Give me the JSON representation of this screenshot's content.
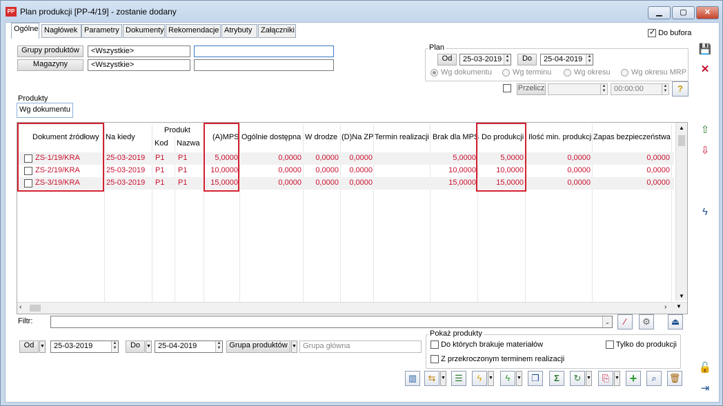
{
  "window": {
    "title": "Plan produkcji [PP-4/19] - zostanie dodany",
    "app_icon": "PP"
  },
  "tabs": [
    "Ogólne",
    "Nagłówek",
    "Parametry",
    "Dokumenty",
    "Rekomendacje",
    "Atrybuty",
    "Załączniki"
  ],
  "do_bufora": {
    "label": "Do bufora",
    "checked": true
  },
  "filters": {
    "grupy_label": "Grupy produktów",
    "grupy_value": "<Wszystkie>",
    "magazyny_label": "Magazyny",
    "magazyny_value": "<Wszystkie>"
  },
  "plan": {
    "label": "Plan",
    "od_label": "Od",
    "od_value": "25-03-2019",
    "do_label": "Do",
    "do_value": "25-04-2019",
    "radios": [
      "Wg dokumentu",
      "Wg terminu",
      "Wg okresu",
      "Wg okresu MRP"
    ],
    "przelicz_label": "Przelicz",
    "time_value": "00:00:00"
  },
  "produkty": {
    "label": "Produkty",
    "subtab": "Wg dokumentu"
  },
  "table": {
    "headers": {
      "dokument": "Dokument źródłowy",
      "na_kiedy": "Na kiedy",
      "produkt": "Produkt",
      "kod": "Kod",
      "nazwa": "Nazwa",
      "amps": "(A)MPS",
      "ogolnie": "Ogólnie dostępna",
      "w_drodze": "W drodze",
      "na_zp": "(D)Na ZP",
      "termin": "Termin realizacji",
      "brak": "Brak dla MPS",
      "do_produkcji": "Do produkcji",
      "ilosc_min": "Ilość min. produkcji",
      "zapas": "Zapas bezpieczeństwa"
    },
    "rows": [
      {
        "doc": "ZS-1/19/KRA",
        "date": "25-03-2019",
        "kod": "P1",
        "nazwa": "P1",
        "amps": "5,0000",
        "ogolnie": "0,0000",
        "w_drodze": "0,0000",
        "na_zp": "0,0000",
        "brak": "5,0000",
        "do_produkcji": "5,0000",
        "ilosc_min": "0,0000",
        "zapas": "0,0000"
      },
      {
        "doc": "ZS-2/19/KRA",
        "date": "25-03-2019",
        "kod": "P1",
        "nazwa": "P1",
        "amps": "10,0000",
        "ogolnie": "0,0000",
        "w_drodze": "0,0000",
        "na_zp": "0,0000",
        "brak": "10,0000",
        "do_produkcji": "10,0000",
        "ilosc_min": "0,0000",
        "zapas": "0,0000"
      },
      {
        "doc": "ZS-3/19/KRA",
        "date": "25-03-2019",
        "kod": "P1",
        "nazwa": "P1",
        "amps": "15,0000",
        "ogolnie": "0,0000",
        "w_drodze": "0,0000",
        "na_zp": "0,0000",
        "brak": "15,0000",
        "do_produkcji": "15,0000",
        "ilosc_min": "0,0000",
        "zapas": "0,0000"
      }
    ]
  },
  "filtr": {
    "label": "Filtr:"
  },
  "bottom": {
    "od_label": "Od",
    "od_value": "25-03-2019",
    "do_label": "Do",
    "do_value": "25-04-2019",
    "grupa_label": "Grupa produktów",
    "grupa_placeholder": "Grupa główna",
    "pokaz_label": "Pokaż produkty",
    "cb1": "Do których brakuje materiałów",
    "cb2": "Z przekroczonym terminem realizacji",
    "cb3": "Tylko do produkcji"
  },
  "colors": {
    "accent_red": "#d3202f",
    "row_text": "#c8102e",
    "window_bg": "#c8d9ec"
  }
}
